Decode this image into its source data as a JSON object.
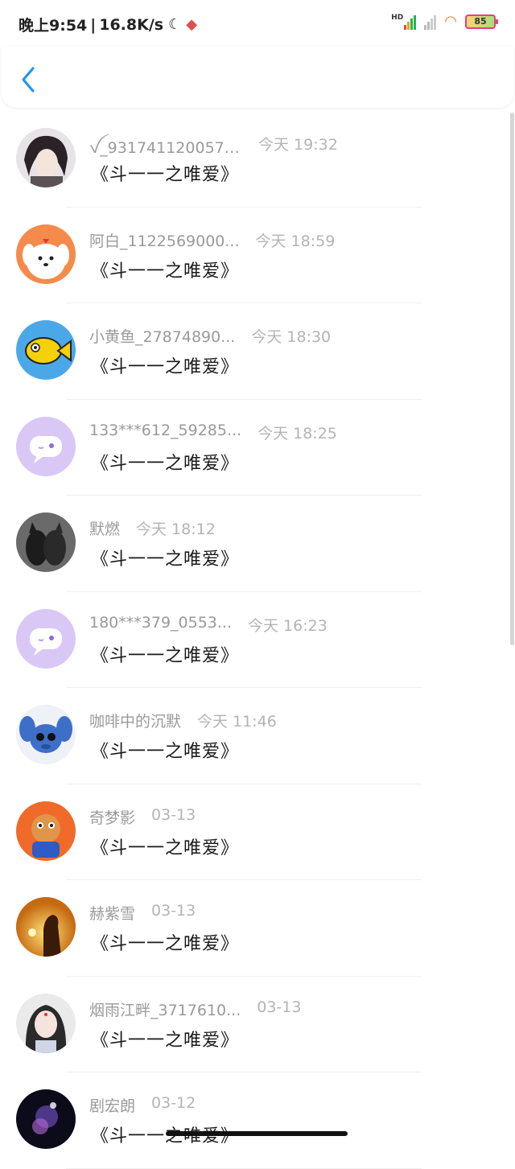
{
  "status_bar": {
    "time": "晚上9:54",
    "speed": "16.8K/s",
    "hd_label": "HD",
    "battery": "85"
  },
  "header": {
    "back_label": "back"
  },
  "messages": [
    {
      "name": "ꪜ_9317411200575...",
      "time": "今天 19:32",
      "text": "《斗一一之唯爱》",
      "avatar": "anime-boy"
    },
    {
      "name": "阿白_1122569000...",
      "time": "今天 18:59",
      "text": "《斗一一之唯爱》",
      "avatar": "dog"
    },
    {
      "name": "小黄鱼_27874890...",
      "time": "今天 18:30",
      "text": "《斗一一之唯爱》",
      "avatar": "fish"
    },
    {
      "name": "133***612_59285...",
      "time": "今天 18:25",
      "text": "《斗一一之唯爱》",
      "avatar": "default"
    },
    {
      "name": "默燃",
      "time": "今天 18:12",
      "text": "《斗一一之唯爱》",
      "avatar": "cats"
    },
    {
      "name": "180***379_0553...",
      "time": "今天 16:23",
      "text": "《斗一一之唯爱》",
      "avatar": "default"
    },
    {
      "name": "咖啡中的沉默",
      "time": "今天 11:46",
      "text": "《斗一一之唯爱》",
      "avatar": "stitch"
    },
    {
      "name": "奇梦影",
      "time": "03-13",
      "text": "《斗一一之唯爱》",
      "avatar": "cartoon"
    },
    {
      "name": "赫紫雪",
      "time": "03-13",
      "text": "《斗一一之唯爱》",
      "avatar": "sunset"
    },
    {
      "name": "烟雨江畔_3717610...",
      "time": "03-13",
      "text": "《斗一一之唯爱》",
      "avatar": "girl"
    },
    {
      "name": "剧宏朗",
      "time": "03-12",
      "text": "《斗一一之唯爱》",
      "avatar": "dark"
    }
  ],
  "colors": {
    "accent": "#2196f3",
    "default_avatar": "#d9c8f5",
    "meta_gray": "#9a9a9a"
  }
}
